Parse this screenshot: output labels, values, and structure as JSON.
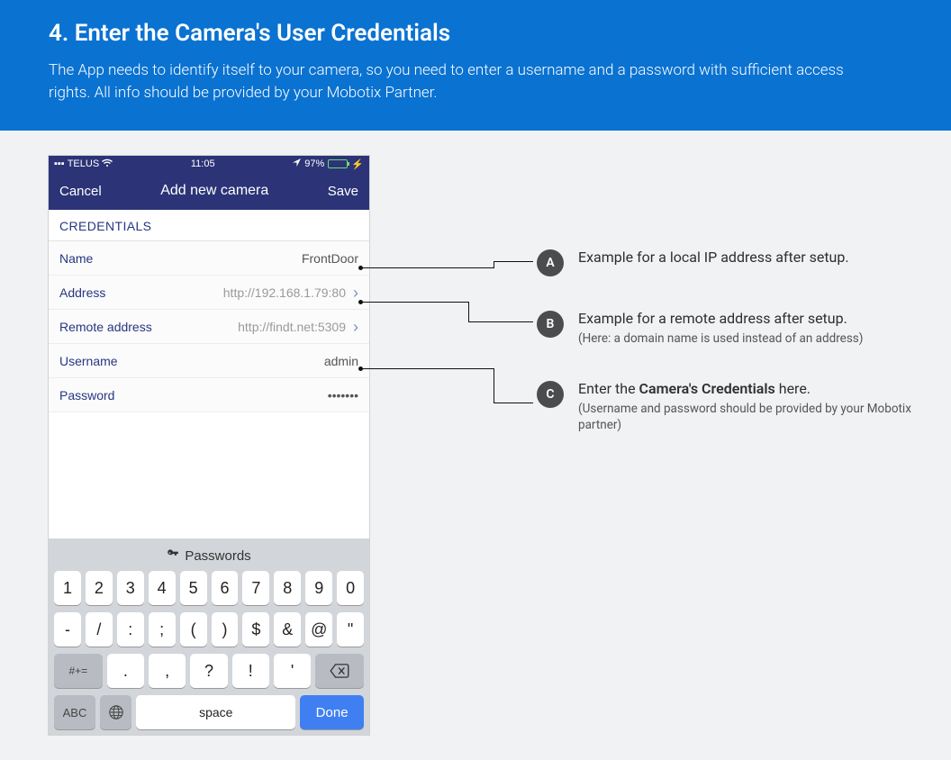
{
  "header": {
    "title": "4. Enter the Camera's User Credentials",
    "subtitle": "The App needs to identify itself to your camera, so you need to enter a username and a password with sufficient access rights. All info should be provided by your Mobotix Partner."
  },
  "phone": {
    "status": {
      "carrier": "TELUS",
      "time": "11:05",
      "battery_pct": "97%"
    },
    "nav": {
      "cancel": "Cancel",
      "title": "Add new camera",
      "save": "Save"
    },
    "section_header": "CREDENTIALS",
    "rows": {
      "name": {
        "label": "Name",
        "value": "FrontDoor"
      },
      "address": {
        "label": "Address",
        "value": "http://192.168.1.79:80"
      },
      "remote": {
        "label": "Remote address",
        "value": "http://findt.net:5309"
      },
      "username": {
        "label": "Username",
        "value": "admin"
      },
      "password": {
        "label": "Password",
        "value": "•••••••"
      }
    },
    "keyboard": {
      "suggest": "Passwords",
      "row1": [
        "1",
        "2",
        "3",
        "4",
        "5",
        "6",
        "7",
        "8",
        "9",
        "0"
      ],
      "row2": [
        "-",
        "/",
        ":",
        ";",
        "(",
        ")",
        "$",
        "&",
        "@",
        "\""
      ],
      "row3_shift": "#+=",
      "row3_mid": [
        ".",
        ",",
        "?",
        "!",
        "'"
      ],
      "row4_abc": "ABC",
      "row4_space": "space",
      "row4_done": "Done"
    }
  },
  "callouts": {
    "a": {
      "badge": "A",
      "text": "Example for a local IP address after setup."
    },
    "b": {
      "badge": "B",
      "text": "Example for a remote address after setup.",
      "sub": "(Here: a domain name is used instead of an address)"
    },
    "c": {
      "badge": "C",
      "text_pre": "Enter the ",
      "text_bold": "Camera's Credentials",
      "text_post": " here.",
      "sub": "(Username and password should be provided by your Mobotix partner)"
    }
  }
}
